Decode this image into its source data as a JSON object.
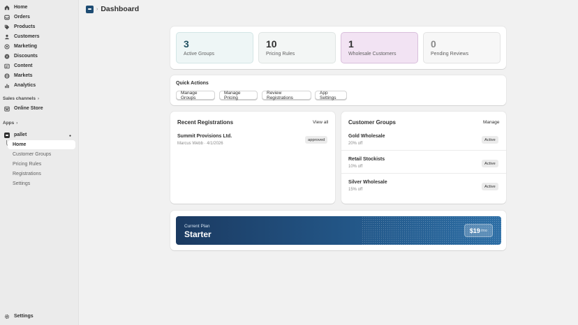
{
  "sidebar": {
    "nav": [
      {
        "label": "Home",
        "icon": "home-icon"
      },
      {
        "label": "Orders",
        "icon": "inbox-icon"
      },
      {
        "label": "Products",
        "icon": "tag-icon"
      },
      {
        "label": "Customers",
        "icon": "person-icon"
      },
      {
        "label": "Marketing",
        "icon": "target-icon"
      },
      {
        "label": "Discounts",
        "icon": "discount-icon"
      },
      {
        "label": "Content",
        "icon": "content-icon"
      },
      {
        "label": "Markets",
        "icon": "globe-icon"
      },
      {
        "label": "Analytics",
        "icon": "bar-chart-icon"
      }
    ],
    "sales_channels_label": "Sales channels",
    "online_store_label": "Online Store",
    "apps_label": "Apps",
    "app_name": "pallet",
    "app_sub": [
      "Home",
      "Customer Groups",
      "Pricing Rules",
      "Registrations",
      "Settings"
    ],
    "settings_label": "Settings"
  },
  "header": {
    "title": "Dashboard"
  },
  "stats": [
    {
      "value": "3",
      "label": "Active Groups",
      "bg": "#eef6f6",
      "border": "#d3e6e6",
      "color": "#1f4e5f"
    },
    {
      "value": "10",
      "label": "Pricing Rules",
      "bg": "#f3f6f5",
      "border": "#dfe5e3",
      "color": "#303030"
    },
    {
      "value": "1",
      "label": "Wholesale Customers",
      "bg": "#f2e3f3",
      "border": "#d9bfdc",
      "color": "#303030"
    },
    {
      "value": "0",
      "label": "Pending Reviews",
      "bg": "#f7f7f7",
      "border": "#e3e3e3",
      "color": "#8a8a8a"
    }
  ],
  "quick_actions": {
    "title": "Quick Actions",
    "buttons": [
      "Manage Groups",
      "Manage Pricing",
      "Review Registrations",
      "App Settings"
    ]
  },
  "recent": {
    "title": "Recent Registrations",
    "link": "View all",
    "items": [
      {
        "name": "Summit Provisions Ltd.",
        "sub": "Marcus Webb · 4/1/2026",
        "status": "approved"
      }
    ]
  },
  "groups": {
    "title": "Customer Groups",
    "link": "Manage",
    "items": [
      {
        "name": "Gold Wholesale",
        "discount": "20% off",
        "status": "Active"
      },
      {
        "name": "Retail Stockists",
        "discount": "10% off",
        "status": "Active"
      },
      {
        "name": "Silver Wholesale",
        "discount": "15% off",
        "status": "Active"
      }
    ]
  },
  "plan": {
    "label": "Current Plan",
    "name": "Starter",
    "price": "$19",
    "period": "/mo"
  }
}
